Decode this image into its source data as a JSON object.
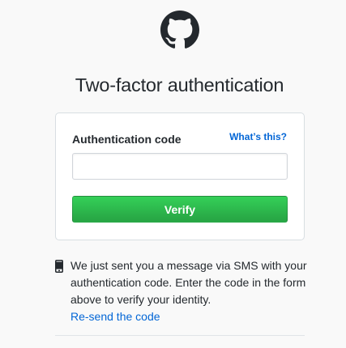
{
  "logo": {
    "icon": "github-mark-icon",
    "color": "#24292e"
  },
  "page": {
    "title": "Two-factor authentication"
  },
  "form": {
    "label": "Authentication code",
    "help_link": "What’s this?",
    "code_value": "",
    "code_placeholder": "",
    "verify_label": "Verify",
    "verify_color": "#28a745"
  },
  "sms": {
    "icon": "mobile-phone-icon",
    "message": "We just sent you a message via SMS with your authentication code. Enter the code in the form above to verify your identity.",
    "resend_label": "Re-send the code"
  },
  "colors": {
    "link": "#0366d6",
    "text": "#24292e",
    "background": "#f9f9f9"
  }
}
